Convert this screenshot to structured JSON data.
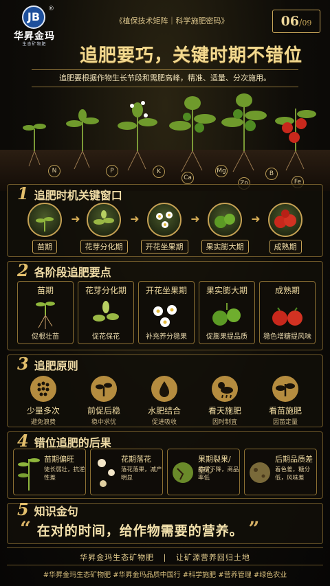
{
  "brand": {
    "mark": "JB",
    "registered": "®",
    "name": "华昇金玛",
    "sub": "生态矿物肥"
  },
  "series": "《植保技术矩阵｜科学施肥密码》",
  "page": {
    "current": "06",
    "total": "09"
  },
  "title": "追肥要巧，关键时期不错位",
  "subtitle": "追肥要根据作物生长节段和需肥高峰，精准、适量、分次施用。",
  "nutrients": [
    "N",
    "P",
    "K",
    "Ca",
    "Mg",
    "Zn",
    "B",
    "Fe"
  ],
  "section1": {
    "num": "1",
    "title": "追肥时机关键窗口",
    "stages": [
      "苗期",
      "花芽分化期",
      "开花坐果期",
      "果实膨大期",
      "成熟期"
    ]
  },
  "section2": {
    "num": "2",
    "title": "各阶段追肥要点",
    "cards": [
      {
        "stage": "苗期",
        "focus": "促根壮苗"
      },
      {
        "stage": "花芽分化期",
        "focus": "促花保花"
      },
      {
        "stage": "开花坐果期",
        "focus": "补充养分稳果"
      },
      {
        "stage": "果实膨大期",
        "focus": "促膨果提品质"
      },
      {
        "stage": "成熟期",
        "focus": "稳色增糖提风味"
      }
    ]
  },
  "section3": {
    "num": "3",
    "title": "追肥原则",
    "principles": [
      {
        "name": "少量多次",
        "desc": "避免浪费"
      },
      {
        "name": "前促后稳",
        "desc": "稳中求优"
      },
      {
        "name": "水肥结合",
        "desc": "促进吸收"
      },
      {
        "name": "看天施肥",
        "desc": "因时制宜"
      },
      {
        "name": "看苗施肥",
        "desc": "因苗定量"
      }
    ]
  },
  "section4": {
    "num": "4",
    "title": "错位追肥的后果",
    "cards": [
      {
        "name": "苗期偏旺",
        "desc": "徒长弱壮，抗逆性差"
      },
      {
        "name": "花期落花",
        "desc": "落花落果，减产明显"
      },
      {
        "name": "果期裂果/空心",
        "desc": "品质下降，商品率低"
      },
      {
        "name": "后期品质差",
        "desc": "着色差，糖分低，风味差"
      }
    ]
  },
  "section5": {
    "num": "5",
    "title": "知识金句",
    "quote": "在对的时间，给作物需要的营养。",
    "open_mark": "“",
    "close_mark": "”"
  },
  "footer": {
    "left": "华昇金玛生态矿物肥",
    "sep": "|",
    "right": "让矿源营养回归土地",
    "tags": "#华昇金玛生态矿物肥  #华昇金玛品质中国行  #科学施肥  #营养管理  #绿色农业"
  },
  "colors": {
    "gold": "#e6c679",
    "background": "#0b0a07",
    "tomato": "#c8281c",
    "leaf": "#6f9a2c"
  }
}
